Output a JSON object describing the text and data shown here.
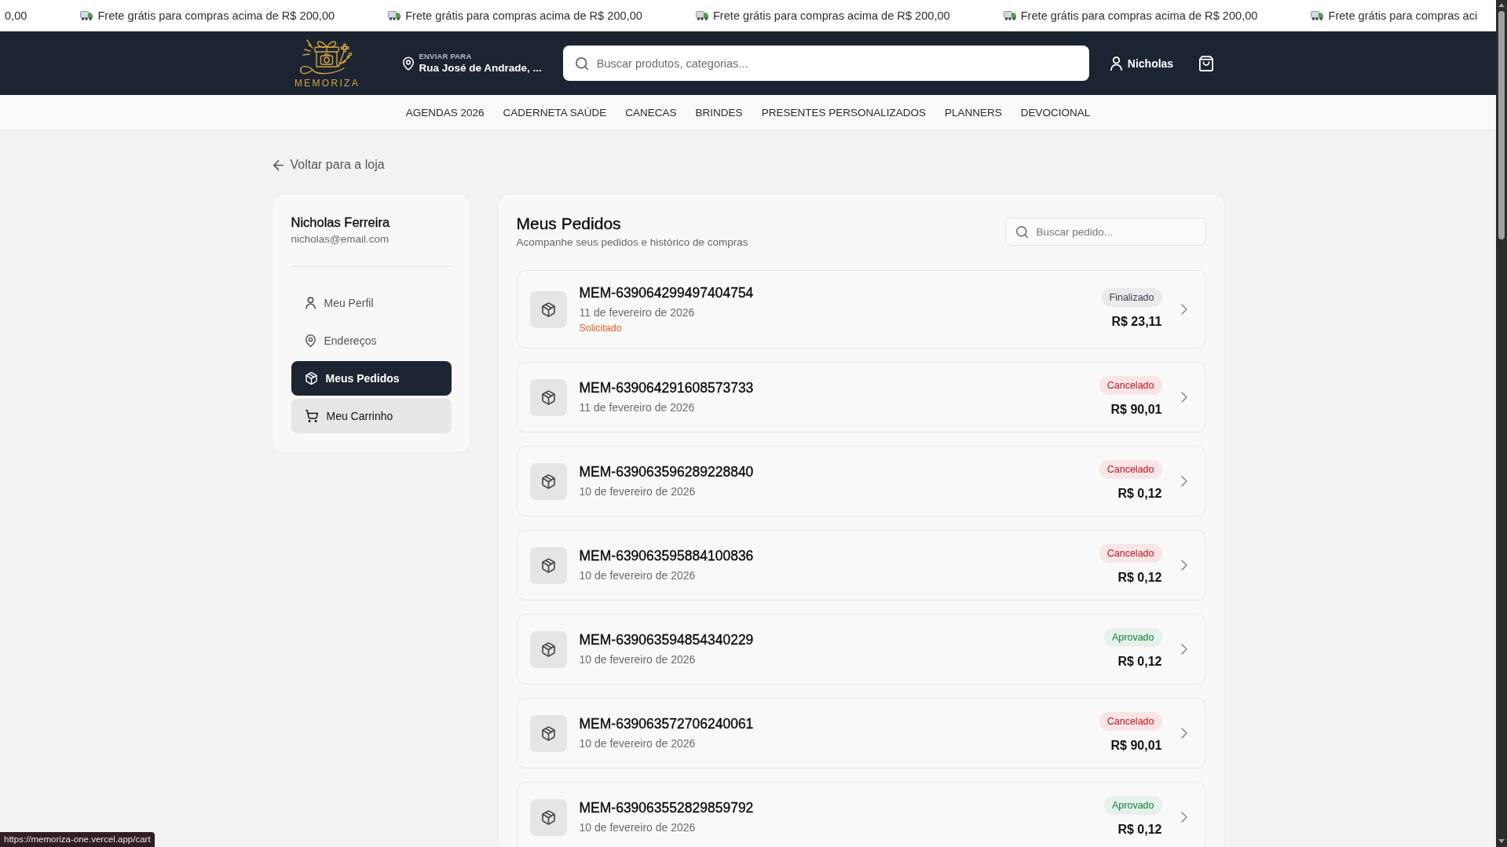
{
  "announcement_bar": {
    "cut_text": "0,00",
    "items": [
      "Frete grátis para compras acima de R$ 200,00",
      "Frete grátis para compras acima de R$ 200,00",
      "Frete grátis para compras acima de R$ 200,00",
      "Frete grátis para compras acima de R$ 200,00",
      "Frete grátis para compras aci"
    ]
  },
  "header": {
    "logo_text": "MEMORIZA",
    "delivery": {
      "label": "ENVIAR PARA",
      "address": "Rua José de Andrade, ..."
    },
    "search": {
      "placeholder": "Buscar produtos, categorias..."
    },
    "user_name": "Nicholas"
  },
  "nav": [
    "AGENDAS 2026",
    "CADERNETA SAÚDE",
    "CANECAS",
    "BRINDES",
    "PRESENTES PERSONALIZADOS",
    "PLANNERS",
    "DEVOCIONAL"
  ],
  "back_link": "Voltar para a loja",
  "sidebar": {
    "name": "Nicholas Ferreira",
    "email": "nicholas@email.com",
    "items": [
      {
        "label": "Meu Perfil",
        "selected": false,
        "hovered": false
      },
      {
        "label": "Endereços",
        "selected": false,
        "hovered": false
      },
      {
        "label": "Meus Pedidos",
        "selected": true,
        "hovered": false
      },
      {
        "label": "Meu Carrinho",
        "selected": false,
        "hovered": true
      }
    ]
  },
  "orders_panel": {
    "title": "Meus Pedidos",
    "subtitle": "Acompanhe seus pedidos e histórico de compras",
    "search": {
      "placeholder": "Buscar pedido..."
    },
    "orders": [
      {
        "number": "MEM-639064299497404754",
        "date": "11 de fevereiro de 2026",
        "note": "Solicitado",
        "status": {
          "label": "Finalizado",
          "color": "#374151"
        },
        "total": "R$ 23,11"
      },
      {
        "number": "MEM-639064291608573733",
        "date": "11 de fevereiro de 2026",
        "status": {
          "label": "Cancelado",
          "color": "#c1121f"
        },
        "total": "R$ 90,01"
      },
      {
        "number": "MEM-639063596289228840",
        "date": "10 de fevereiro de 2026",
        "status": {
          "label": "Cancelado",
          "color": "#c1121f"
        },
        "total": "R$ 0,12"
      },
      {
        "number": "MEM-639063595884100836",
        "date": "10 de fevereiro de 2026",
        "status": {
          "label": "Cancelado",
          "color": "#c1121f"
        },
        "total": "R$ 0,12"
      },
      {
        "number": "MEM-639063594854340229",
        "date": "10 de fevereiro de 2026",
        "status": {
          "label": "Aprovado",
          "color": "#15803d"
        },
        "total": "R$ 0,12"
      },
      {
        "number": "MEM-639063572706240061",
        "date": "10 de fevereiro de 2026",
        "status": {
          "label": "Cancelado",
          "color": "#c1121f"
        },
        "total": "R$ 90,01"
      },
      {
        "number": "MEM-639063552829859792",
        "date": "10 de fevereiro de 2026",
        "status": {
          "label": "Aprovado",
          "color": "#15803d"
        },
        "total": "R$ 0,12"
      }
    ]
  },
  "status_url": "https://memoriza-one.vercel.app/cart"
}
